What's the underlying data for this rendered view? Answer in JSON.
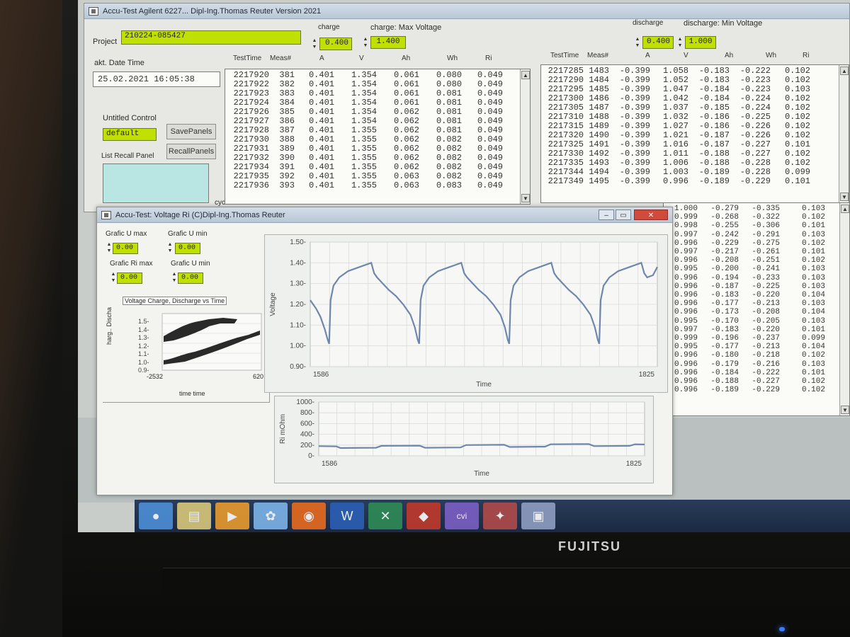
{
  "main_window": {
    "title": "Accu-Test Agilent 6227... Dipl-Ing.Thomas Reuter Version 2021",
    "project_label": "Project",
    "project_value": "210224-085427",
    "date_label": "akt. Date Time",
    "date_value": "25.02.2021 16:05:38",
    "charge_label": "charge",
    "charge_value": "0.400",
    "charge_maxv_label": "charge: Max Voltage",
    "charge_maxv_value": "1.400",
    "discharge_label": "discharge",
    "discharge_value": "0.400",
    "discharge_minv_label": "discharge: Min Voltage",
    "discharge_minv_value": "1.000",
    "untitled_control_label": "Untitled Control",
    "untitled_control_value": "default",
    "save_panels": "SavePanels",
    "list_recall_label": "List Recall Panel",
    "recall_panels": "RecallPanels",
    "cycle_label": "cycle#"
  },
  "charge_table": {
    "headers": [
      "TestTime",
      "Meas#",
      "A",
      "V",
      "Ah",
      "Wh",
      "Ri"
    ],
    "rows": [
      [
        "2217920",
        "381",
        "0.401",
        "1.354",
        "0.061",
        "0.080",
        "0.049"
      ],
      [
        "2217922",
        "382",
        "0.401",
        "1.354",
        "0.061",
        "0.080",
        "0.049"
      ],
      [
        "2217923",
        "383",
        "0.401",
        "1.354",
        "0.061",
        "0.081",
        "0.049"
      ],
      [
        "2217924",
        "384",
        "0.401",
        "1.354",
        "0.061",
        "0.081",
        "0.049"
      ],
      [
        "2217926",
        "385",
        "0.401",
        "1.354",
        "0.062",
        "0.081",
        "0.049"
      ],
      [
        "2217927",
        "386",
        "0.401",
        "1.354",
        "0.062",
        "0.081",
        "0.049"
      ],
      [
        "2217928",
        "387",
        "0.401",
        "1.355",
        "0.062",
        "0.081",
        "0.049"
      ],
      [
        "2217930",
        "388",
        "0.401",
        "1.355",
        "0.062",
        "0.082",
        "0.049"
      ],
      [
        "2217931",
        "389",
        "0.401",
        "1.355",
        "0.062",
        "0.082",
        "0.049"
      ],
      [
        "2217932",
        "390",
        "0.401",
        "1.355",
        "0.062",
        "0.082",
        "0.049"
      ],
      [
        "2217934",
        "391",
        "0.401",
        "1.355",
        "0.062",
        "0.082",
        "0.049"
      ],
      [
        "2217935",
        "392",
        "0.401",
        "1.355",
        "0.063",
        "0.082",
        "0.049"
      ],
      [
        "2217936",
        "393",
        "0.401",
        "1.355",
        "0.063",
        "0.083",
        "0.049"
      ]
    ]
  },
  "discharge_table": {
    "headers": [
      "TestTime",
      "Meas#",
      "A",
      "V",
      "Ah",
      "Wh",
      "Ri"
    ],
    "rows": [
      [
        "2217285",
        "1483",
        "-0.399",
        "1.058",
        "-0.183",
        "-0.222",
        "0.102"
      ],
      [
        "2217290",
        "1484",
        "-0.399",
        "1.052",
        "-0.183",
        "-0.223",
        "0.102"
      ],
      [
        "2217295",
        "1485",
        "-0.399",
        "1.047",
        "-0.184",
        "-0.223",
        "0.103"
      ],
      [
        "2217300",
        "1486",
        "-0.399",
        "1.042",
        "-0.184",
        "-0.224",
        "0.102"
      ],
      [
        "2217305",
        "1487",
        "-0.399",
        "1.037",
        "-0.185",
        "-0.224",
        "0.102"
      ],
      [
        "2217310",
        "1488",
        "-0.399",
        "1.032",
        "-0.186",
        "-0.225",
        "0.102"
      ],
      [
        "2217315",
        "1489",
        "-0.399",
        "1.027",
        "-0.186",
        "-0.226",
        "0.102"
      ],
      [
        "2217320",
        "1490",
        "-0.399",
        "1.021",
        "-0.187",
        "-0.226",
        "0.102"
      ],
      [
        "2217325",
        "1491",
        "-0.399",
        "1.016",
        "-0.187",
        "-0.227",
        "0.101"
      ],
      [
        "2217330",
        "1492",
        "-0.399",
        "1.011",
        "-0.188",
        "-0.227",
        "0.102"
      ],
      [
        "2217335",
        "1493",
        "-0.399",
        "1.006",
        "-0.188",
        "-0.228",
        "0.102"
      ],
      [
        "2217344",
        "1494",
        "-0.399",
        "1.003",
        "-0.189",
        "-0.228",
        "0.099"
      ],
      [
        "2217349",
        "1495",
        "-0.399",
        "0.996",
        "-0.189",
        "-0.229",
        "0.101"
      ]
    ]
  },
  "cycle_table": {
    "rows": [
      [
        "1.000",
        "-0.279",
        "-0.335",
        "0.103"
      ],
      [
        "0.999",
        "-0.268",
        "-0.322",
        "0.102"
      ],
      [
        "0.998",
        "-0.255",
        "-0.306",
        "0.101"
      ],
      [
        "0.997",
        "-0.242",
        "-0.291",
        "0.103"
      ],
      [
        "0.996",
        "-0.229",
        "-0.275",
        "0.102"
      ],
      [
        "0.997",
        "-0.217",
        "-0.261",
        "0.101"
      ],
      [
        "0.996",
        "-0.208",
        "-0.251",
        "0.102"
      ],
      [
        "0.995",
        "-0.200",
        "-0.241",
        "0.103"
      ],
      [
        "0.996",
        "-0.194",
        "-0.233",
        "0.103"
      ],
      [
        "0.996",
        "-0.187",
        "-0.225",
        "0.103"
      ],
      [
        "0.996",
        "-0.183",
        "-0.220",
        "0.104"
      ],
      [
        "0.996",
        "-0.177",
        "-0.213",
        "0.103"
      ],
      [
        "0.996",
        "-0.173",
        "-0.208",
        "0.104"
      ],
      [
        "0.995",
        "-0.170",
        "-0.205",
        "0.103"
      ],
      [
        "0.997",
        "-0.183",
        "-0.220",
        "0.101"
      ],
      [
        "0.999",
        "-0.196",
        "-0.237",
        "0.099"
      ],
      [
        "0.995",
        "-0.177",
        "-0.213",
        "0.104"
      ],
      [
        "0.996",
        "-0.180",
        "-0.218",
        "0.102"
      ],
      [
        "0.996",
        "-0.179",
        "-0.216",
        "0.103"
      ],
      [
        "0.996",
        "-0.184",
        "-0.222",
        "0.101"
      ],
      [
        "0.996",
        "-0.188",
        "-0.227",
        "0.102"
      ],
      [
        "0.996",
        "-0.189",
        "-0.229",
        "0.102"
      ]
    ]
  },
  "graph_window": {
    "title": "Accu-Test: Voltage Ri (C)Dipl-Ing.Thomas Reuter",
    "umax_label": "Grafic U max",
    "umax_value": "0.00",
    "umin_label": "Grafic U min",
    "umin_value": "0.00",
    "rimax_label": "Grafic Ri max",
    "rimax_value": "0.00",
    "umin2_label": "Grafic U min",
    "umin2_value": "0.00",
    "mini_title": "Voltage Charge, Discharge vs Time",
    "mini_ylabel": "harg.. Discha",
    "mini_xlabel": "time time",
    "mini_yticks": [
      "1.5-",
      "1.4-",
      "1.3-",
      "1.2-",
      "1.1-",
      "1.0-",
      "0.9-"
    ],
    "mini_xmin": "-2532",
    "mini_xmax": "620"
  },
  "chart_data": [
    {
      "type": "line",
      "title": "",
      "xlabel": "Time",
      "ylabel": "Voltage",
      "ylim": [
        0.9,
        1.5
      ],
      "xlim": [
        1586,
        1825
      ],
      "yticks": [
        "1.50",
        "1.40",
        "1.30",
        "1.20",
        "1.10",
        "1.00",
        "0.90"
      ],
      "xticks": [
        "1586",
        "1825"
      ],
      "grid": true,
      "series": [
        {
          "x": [
            1586,
            1590,
            1593,
            1596,
            1598,
            1599,
            1600,
            1602,
            1606,
            1612,
            1620,
            1628,
            1630,
            1632,
            1636,
            1640,
            1645,
            1650,
            1655,
            1658,
            1660,
            1661,
            1662,
            1664,
            1668,
            1674,
            1682,
            1690,
            1692,
            1694,
            1698,
            1702,
            1707,
            1712,
            1717,
            1720,
            1722,
            1723,
            1724,
            1726,
            1730,
            1736,
            1744,
            1752,
            1754,
            1756,
            1760,
            1764,
            1769,
            1774,
            1779,
            1782,
            1784,
            1785,
            1786,
            1788,
            1792,
            1798,
            1806,
            1814,
            1816,
            1818,
            1822,
            1825
          ],
          "y": [
            1.22,
            1.18,
            1.14,
            1.08,
            1.03,
            1.01,
            1.22,
            1.29,
            1.33,
            1.36,
            1.38,
            1.4,
            1.35,
            1.33,
            1.3,
            1.27,
            1.24,
            1.2,
            1.15,
            1.09,
            1.03,
            1.01,
            1.22,
            1.29,
            1.33,
            1.36,
            1.38,
            1.4,
            1.35,
            1.33,
            1.3,
            1.27,
            1.24,
            1.2,
            1.15,
            1.09,
            1.03,
            1.01,
            1.22,
            1.29,
            1.33,
            1.36,
            1.38,
            1.4,
            1.35,
            1.33,
            1.3,
            1.27,
            1.24,
            1.2,
            1.15,
            1.09,
            1.03,
            1.01,
            1.22,
            1.29,
            1.33,
            1.36,
            1.38,
            1.4,
            1.35,
            1.33,
            1.34,
            1.38
          ]
        }
      ]
    },
    {
      "type": "line",
      "title": "",
      "xlabel": "Time",
      "ylabel": "Ri mOhm",
      "ylim": [
        0,
        1000
      ],
      "xlim": [
        1586,
        1825
      ],
      "yticks": [
        "1000",
        "800",
        "600",
        "400",
        "200",
        "0"
      ],
      "xticks": [
        "1586",
        "1825"
      ],
      "grid": true,
      "series": [
        {
          "x": [
            1586,
            1599,
            1602,
            1628,
            1632,
            1660,
            1664,
            1690,
            1694,
            1722,
            1726,
            1752,
            1756,
            1784,
            1788,
            1814,
            1818,
            1825
          ],
          "y": [
            180,
            175,
            145,
            150,
            185,
            190,
            150,
            155,
            200,
            205,
            165,
            170,
            215,
            220,
            180,
            185,
            215,
            210
          ]
        }
      ]
    }
  ],
  "taskbar": {
    "items": [
      {
        "name": "start-orb-icon",
        "glyph": "●",
        "color": "#4d8fd6"
      },
      {
        "name": "explorer-icon",
        "glyph": "▤",
        "color": "#d8c77a"
      },
      {
        "name": "media-player-icon",
        "glyph": "▶",
        "color": "#e89a2e"
      },
      {
        "name": "network-icon",
        "glyph": "✿",
        "color": "#7db4e8"
      },
      {
        "name": "firefox-icon",
        "glyph": "◉",
        "color": "#e86a1e"
      },
      {
        "name": "word-icon",
        "glyph": "W",
        "color": "#2b5fb5"
      },
      {
        "name": "excel-icon",
        "glyph": "✕",
        "color": "#2e8b57"
      },
      {
        "name": "app-red-icon",
        "glyph": "◆",
        "color": "#c0392b"
      },
      {
        "name": "cvi-icon",
        "glyph": "cvi",
        "color": "#7b5fc4"
      },
      {
        "name": "tool-icon",
        "glyph": "✦",
        "color": "#b04a4a"
      },
      {
        "name": "accutest-icon",
        "glyph": "▣",
        "color": "#8e9ec2"
      }
    ]
  },
  "brand": "FUJITSU"
}
